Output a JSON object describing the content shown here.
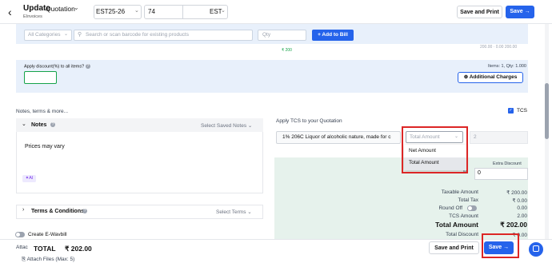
{
  "header": {
    "back_icon": "chevron-left-icon",
    "title": "Update",
    "doc_type": "Quotation",
    "org_name": "EInvoices",
    "series": "EST25-26",
    "doc_number": "74",
    "prefix": "EST",
    "save_print_label": "Save and Print",
    "save_label": "Save",
    "save_arrow": "→"
  },
  "items_panel": {
    "category_placeholder": "All Categories",
    "search_placeholder": "Search or scan barcode for existing products",
    "qty_placeholder": "Qty",
    "add_to_bill_label": "+ Add to Bill",
    "faded_amount": "200.00 · 0.00 200.00",
    "green_mark": "₹ 200",
    "apply_discount_label": "Apply discount(%) to all items?",
    "items_count": "Items: 1, Qty: 1.000",
    "additional_charges_label": "Additional Charges",
    "discount_value": ""
  },
  "notes": {
    "section_label": "Notes, terms & more...",
    "title": "Notes",
    "select_saved": "Select Saved Notes",
    "text": "Prices may vary",
    "ai_badge": "AI"
  },
  "terms": {
    "title": "Terms & Conditions",
    "select_terms": "Select Terms"
  },
  "ewaybill": {
    "label": "Create E-Wavbill"
  },
  "tcs": {
    "checkbox_label": "TCS",
    "apply_label": "Apply TCS to your Quotation",
    "selected_tcs": "1% 206C  Liquor of alcoholic nature, made for c",
    "rate_value": "2",
    "dropdown_placeholder": "Total Amount",
    "dropdown_options": [
      "Net Amount",
      "Total Amount"
    ],
    "highlighted_option": "Total Amount"
  },
  "summary": {
    "extra_discount_label": "Extra Discount",
    "extra_discount_unit": "%",
    "extra_discount_value": "0",
    "rows": [
      {
        "label": "Taxable Amount",
        "value": "₹ 200.00"
      },
      {
        "label": "Total Tax",
        "value": "₹ 0.00"
      },
      {
        "label": "Round Off",
        "value": "0.00"
      },
      {
        "label": "TCS Amount",
        "value": "2.00"
      }
    ],
    "grand_total_label": "Total Amount",
    "grand_total_value": "₹ 202.00",
    "total_discount_label": "Total Discount",
    "total_discount_value": "₹ 0.00"
  },
  "footer": {
    "attach_label": "Attac",
    "attach_files_label": "Attach Files (Max: 5)",
    "total_label": "TOTAL",
    "total_value": "₹ 202.00",
    "save_print_label": "Save and Print",
    "save_label": "Save",
    "save_arrow": "→"
  },
  "colors": {
    "primary": "#2563eb",
    "highlight": "#dc2626",
    "panel_blue": "#e8f0fb",
    "panel_green": "#e6f2ec"
  }
}
